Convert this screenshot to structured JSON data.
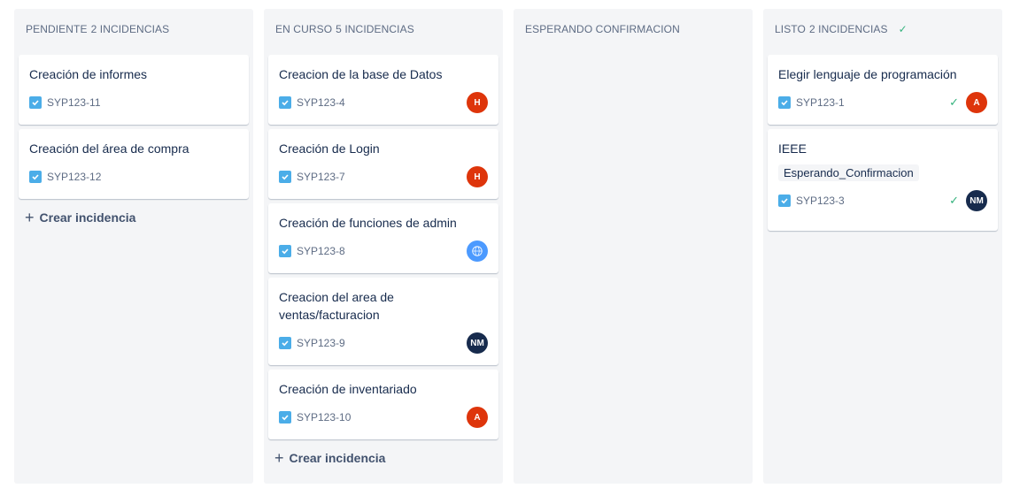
{
  "columns": [
    {
      "title": "PENDIENTE",
      "count": "2 INCIDENCIAS",
      "cards": [
        {
          "title": "Creación de informes",
          "key": "SYP123-11"
        },
        {
          "title": "Creación del área de compra",
          "key": "SYP123-12"
        }
      ],
      "create_label": "Crear incidencia"
    },
    {
      "title": "EN CURSO",
      "count": "5 INCIDENCIAS",
      "cards": [
        {
          "title": "Creacion de la base de Datos",
          "key": "SYP123-4",
          "avatar": "H"
        },
        {
          "title": "Creación de Login",
          "key": "SYP123-7",
          "avatar": "H"
        },
        {
          "title": "Creación de funciones de admin",
          "key": "SYP123-8",
          "avatar": "globe-avatar-icon"
        },
        {
          "title": "Creacion del area de ventas/facturacion",
          "key": "SYP123-9",
          "avatar": "NM"
        },
        {
          "title": "Creación de inventariado",
          "key": "SYP123-10",
          "avatar": "A"
        }
      ],
      "create_label": "Crear incidencia"
    },
    {
      "title": "ESPERANDO CONFIRMACION",
      "count": "",
      "cards": []
    },
    {
      "title": "LISTO",
      "count": "2 INCIDENCIAS",
      "cards": [
        {
          "title": "Elegir lenguaje de programación",
          "key": "SYP123-1",
          "avatar": "A"
        },
        {
          "title": "IEEE",
          "label": "Esperando_Confirmacion",
          "key": "SYP123-3",
          "avatar": "NM"
        }
      ]
    }
  ],
  "colors": {
    "column_bg": "#f4f5f7",
    "task_icon": "#4bade8",
    "avatar_red": "#de350b",
    "avatar_navy": "#172b4d",
    "avatar_blue": "#4c9aff",
    "done_green": "#36b37e"
  }
}
